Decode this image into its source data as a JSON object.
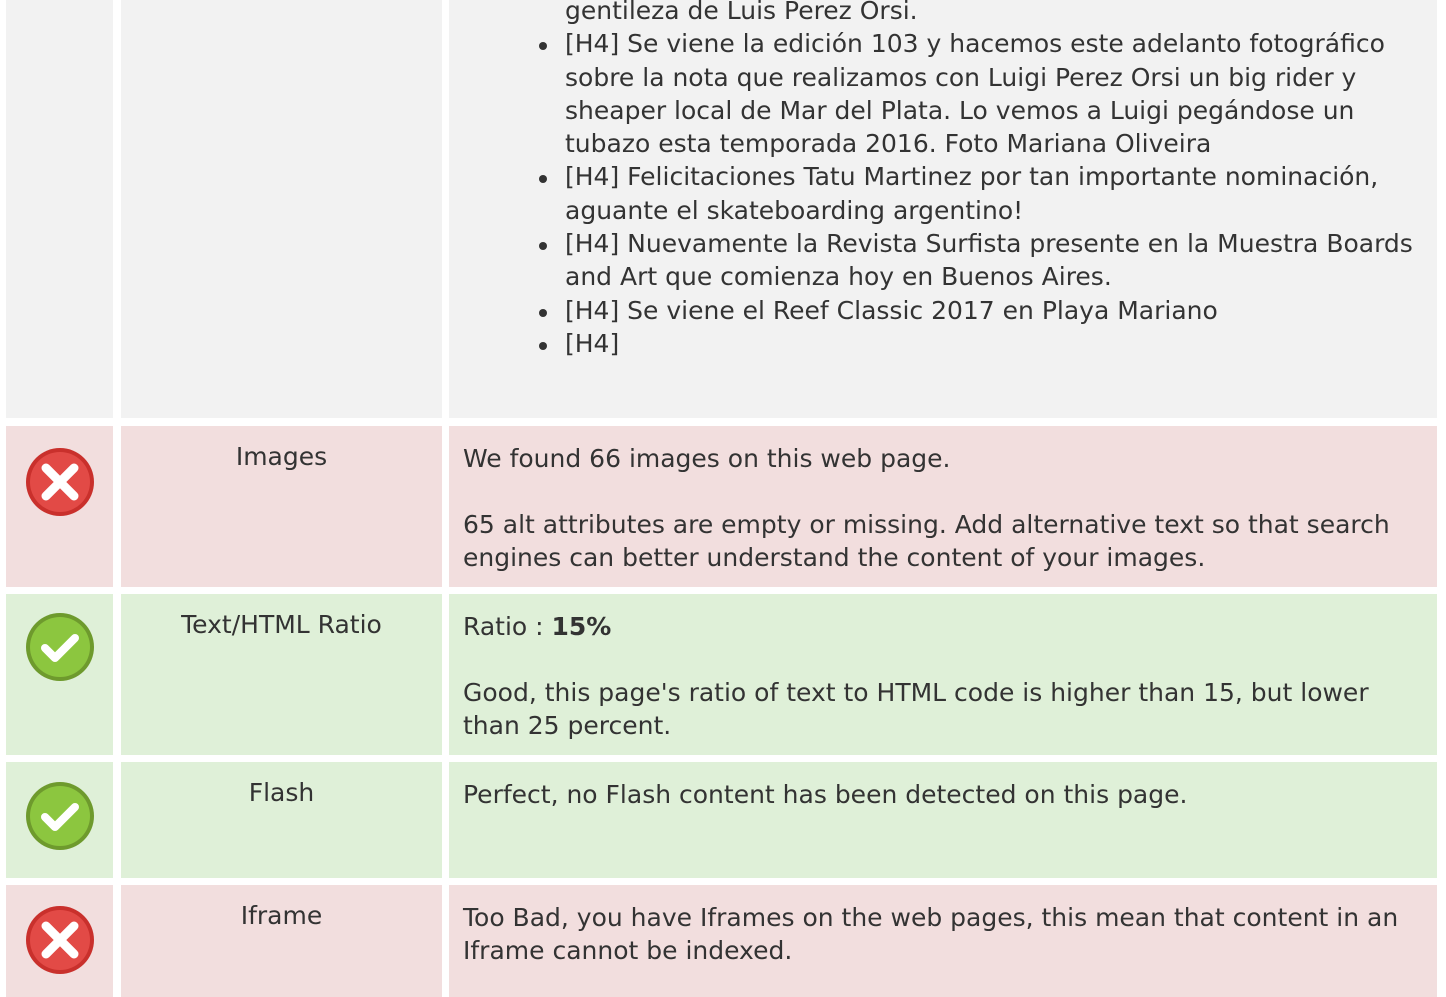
{
  "colors": {
    "neutral_bg": "#f2f2f2",
    "error_bg": "#f2dede",
    "success_bg": "#dff0d8",
    "error_icon": "#d9534f",
    "success_icon": "#8cc63f"
  },
  "headings": {
    "continuation": "gentileza de Luis Perez Orsi.",
    "items": [
      "[H4] Se viene la edición 103 y hacemos este adelanto fotográfico sobre la nota que realizamos con Luigi Perez Orsi un big rider y sheaper local de Mar del Plata. Lo vemos a Luigi pegándose un tubazo esta temporada 2016. Foto Mariana Oliveira",
      "[H4] Felicitaciones Tatu Martinez por tan importante nominación, aguante el skateboarding argentino!",
      "[H4] Nuevamente la Revista Surfista presente en la Muestra Boards and Art que comienza hoy en Buenos Aires.",
      "[H4] Se viene el Reef Classic 2017 en Playa Mariano",
      "[H4]"
    ]
  },
  "rows": {
    "images": {
      "status": "error",
      "icon": "cross-icon",
      "label": "Images",
      "line1": "We found 66 images on this web page.",
      "line2": "65 alt attributes are empty or missing. Add alternative text so that search engines can better understand the content of your images."
    },
    "ratio": {
      "status": "success",
      "icon": "check-icon",
      "label": "Text/HTML Ratio",
      "prefix": "Ratio : ",
      "value": "15%",
      "line2": "Good, this page's ratio of text to HTML code is higher than 15, but lower than 25 percent."
    },
    "flash": {
      "status": "success",
      "icon": "check-icon",
      "label": "Flash",
      "line1": "Perfect, no Flash content has been detected on this page."
    },
    "iframe": {
      "status": "error",
      "icon": "cross-icon",
      "label": "Iframe",
      "line1": "Too Bad, you have Iframes on the web pages, this mean that content in an Iframe cannot be indexed."
    }
  }
}
